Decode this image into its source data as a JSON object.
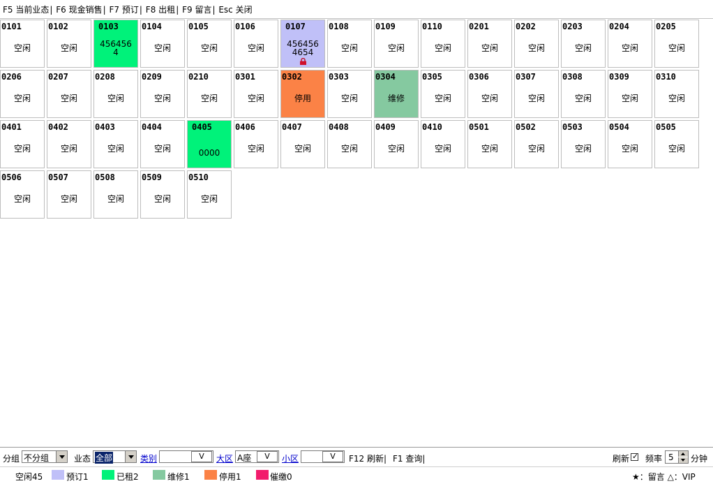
{
  "menu": [
    {
      "key": "F5",
      "label": "当前业态"
    },
    {
      "key": "F6",
      "label": "现金销售"
    },
    {
      "key": "F7",
      "label": "预订"
    },
    {
      "key": "F8",
      "label": "出租"
    },
    {
      "key": "F9",
      "label": "留言"
    },
    {
      "key": "Esc",
      "label": "关闭"
    }
  ],
  "status_colors": {
    "free": "#ffffff",
    "reserved": "#c0c0f8",
    "rented": "#00f27a",
    "repair": "#85c9a0",
    "disabled": "#fb8246",
    "overdue": "#f21c6c"
  },
  "rooms": [
    {
      "no": "0101",
      "status": "free",
      "lines": [
        "空闲"
      ]
    },
    {
      "no": "0102",
      "status": "free",
      "lines": [
        "空闲"
      ]
    },
    {
      "no": "0103",
      "status": "rented",
      "lines": [
        "456456",
        "4"
      ]
    },
    {
      "no": "0104",
      "status": "free",
      "lines": [
        "空闲"
      ]
    },
    {
      "no": "0105",
      "status": "free",
      "lines": [
        "空闲"
      ]
    },
    {
      "no": "0106",
      "status": "free",
      "lines": [
        "空闲"
      ]
    },
    {
      "no": "0107",
      "status": "reserved",
      "lines": [
        "456456",
        "4654"
      ],
      "icon": "lock-icon"
    },
    {
      "no": "0108",
      "status": "free",
      "lines": [
        "空闲"
      ]
    },
    {
      "no": "0109",
      "status": "free",
      "lines": [
        "空闲"
      ]
    },
    {
      "no": "0110",
      "status": "free",
      "lines": [
        "空闲"
      ]
    },
    {
      "no": "0201",
      "status": "free",
      "lines": [
        "空闲"
      ]
    },
    {
      "no": "0202",
      "status": "free",
      "lines": [
        "空闲"
      ]
    },
    {
      "no": "0203",
      "status": "free",
      "lines": [
        "空闲"
      ]
    },
    {
      "no": "0204",
      "status": "free",
      "lines": [
        "空闲"
      ]
    },
    {
      "no": "0205",
      "status": "free",
      "lines": [
        "空闲"
      ]
    },
    {
      "no": "0206",
      "status": "free",
      "lines": [
        "空闲"
      ]
    },
    {
      "no": "0207",
      "status": "free",
      "lines": [
        "空闲"
      ]
    },
    {
      "no": "0208",
      "status": "free",
      "lines": [
        "空闲"
      ]
    },
    {
      "no": "0209",
      "status": "free",
      "lines": [
        "空闲"
      ]
    },
    {
      "no": "0210",
      "status": "free",
      "lines": [
        "空闲"
      ]
    },
    {
      "no": "0301",
      "status": "free",
      "lines": [
        "空闲"
      ]
    },
    {
      "no": "0302",
      "status": "disabled",
      "lines": [
        "停用"
      ]
    },
    {
      "no": "0303",
      "status": "free",
      "lines": [
        "空闲"
      ]
    },
    {
      "no": "0304",
      "status": "repair",
      "lines": [
        "维修"
      ]
    },
    {
      "no": "0305",
      "status": "free",
      "lines": [
        "空闲"
      ]
    },
    {
      "no": "0306",
      "status": "free",
      "lines": [
        "空闲"
      ]
    },
    {
      "no": "0307",
      "status": "free",
      "lines": [
        "空闲"
      ]
    },
    {
      "no": "0308",
      "status": "free",
      "lines": [
        "空闲"
      ]
    },
    {
      "no": "0309",
      "status": "free",
      "lines": [
        "空闲"
      ]
    },
    {
      "no": "0310",
      "status": "free",
      "lines": [
        "空闲"
      ]
    },
    {
      "no": "0401",
      "status": "free",
      "lines": [
        "空闲"
      ]
    },
    {
      "no": "0402",
      "status": "free",
      "lines": [
        "空闲"
      ]
    },
    {
      "no": "0403",
      "status": "free",
      "lines": [
        "空闲"
      ]
    },
    {
      "no": "0404",
      "status": "free",
      "lines": [
        "空闲"
      ]
    },
    {
      "no": "0405",
      "status": "rented",
      "lines": [
        "0000"
      ]
    },
    {
      "no": "0406",
      "status": "free",
      "lines": [
        "空闲"
      ]
    },
    {
      "no": "0407",
      "status": "free",
      "lines": [
        "空闲"
      ]
    },
    {
      "no": "0408",
      "status": "free",
      "lines": [
        "空闲"
      ]
    },
    {
      "no": "0409",
      "status": "free",
      "lines": [
        "空闲"
      ]
    },
    {
      "no": "0410",
      "status": "free",
      "lines": [
        "空闲"
      ]
    },
    {
      "no": "0501",
      "status": "free",
      "lines": [
        "空闲"
      ]
    },
    {
      "no": "0502",
      "status": "free",
      "lines": [
        "空闲"
      ]
    },
    {
      "no": "0503",
      "status": "free",
      "lines": [
        "空闲"
      ]
    },
    {
      "no": "0504",
      "status": "free",
      "lines": [
        "空闲"
      ]
    },
    {
      "no": "0505",
      "status": "free",
      "lines": [
        "空闲"
      ]
    },
    {
      "no": "0506",
      "status": "free",
      "lines": [
        "空闲"
      ]
    },
    {
      "no": "0507",
      "status": "free",
      "lines": [
        "空闲"
      ]
    },
    {
      "no": "0508",
      "status": "free",
      "lines": [
        "空闲"
      ]
    },
    {
      "no": "0509",
      "status": "free",
      "lines": [
        "空闲"
      ]
    },
    {
      "no": "0510",
      "status": "free",
      "lines": [
        "空闲"
      ]
    }
  ],
  "filters": {
    "group_label": "分组",
    "group_value": "不分组",
    "status_label": "业态",
    "status_value": "全部",
    "category_label": "类别",
    "category_value": "",
    "category_btn": "V",
    "zone_label": "大区",
    "zone_value": "A座",
    "zone_btn": "V",
    "subzone_label": "小区",
    "subzone_value": "",
    "subzone_btn": "V",
    "f12_label": "F12 刷新|",
    "f1_label": "F1 查询|",
    "refresh_label": "刷新",
    "refresh_checked": "✓",
    "rate_label": "频率",
    "rate_value": "5",
    "minute_label": "分钟"
  },
  "legend": {
    "free": "空闲45",
    "reserved": "预订1",
    "rented": "已租2",
    "repair": "维修1",
    "disabled": "停用1",
    "overdue": "催缴0",
    "note": "★：留言 △：VIP"
  }
}
